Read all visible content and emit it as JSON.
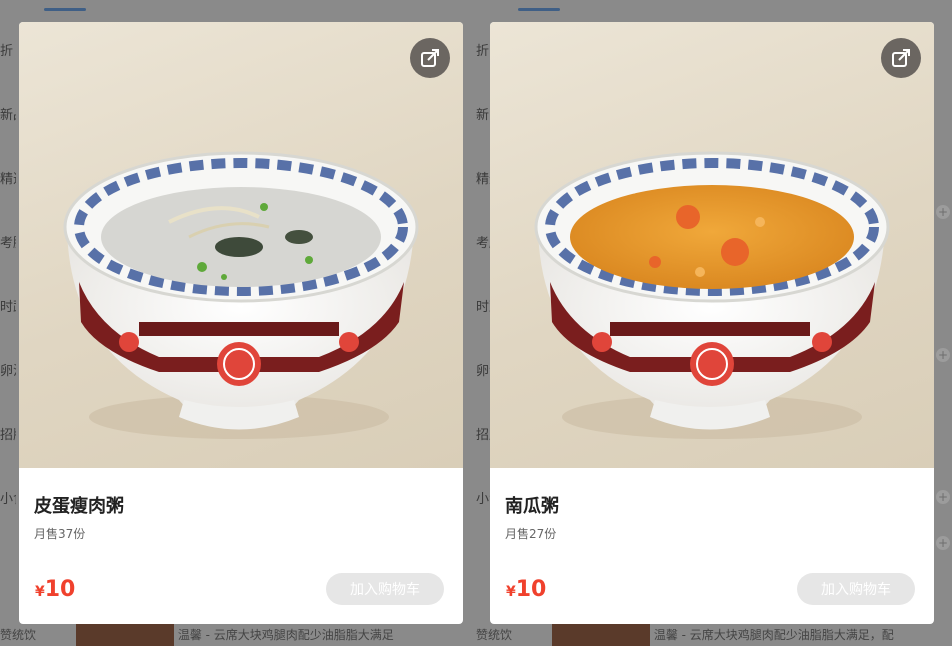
{
  "background": {
    "left_panel_side_labels": [
      "折",
      "新品",
      "精选",
      "考脑",
      "时蔬",
      "卵汁",
      "招牌",
      "小食"
    ],
    "right_panel_side_labels": [
      "折",
      "新品",
      "精选",
      "考脑",
      "时蔬",
      "卵汁",
      "招牌",
      "小食"
    ],
    "bottom_text_left": "赞统饮",
    "bottom_desc_left": "温馨 - 云席大块鸡腿肉配少油脂脂大满足",
    "bottom_text_right": "赞统饮",
    "bottom_desc_right": "温馨 - 云席大块鸡腿肉配少油脂脂大满足，配"
  },
  "products": [
    {
      "name": "皮蛋瘦肉粥",
      "sales": "月售37份",
      "currency": "¥",
      "price": "10",
      "add_to_cart": "加入购物车",
      "share_icon": "share-icon",
      "congee_color": "#d6d6d2"
    },
    {
      "name": "南瓜粥",
      "sales": "月售27份",
      "currency": "¥",
      "price": "10",
      "add_to_cart": "加入购物车",
      "share_icon": "share-icon",
      "congee_color": "#e39a2a"
    }
  ],
  "colors": {
    "price": "#f0412d",
    "disabled_button": "#e6e6e6",
    "overlay": "#6f6f6f"
  }
}
